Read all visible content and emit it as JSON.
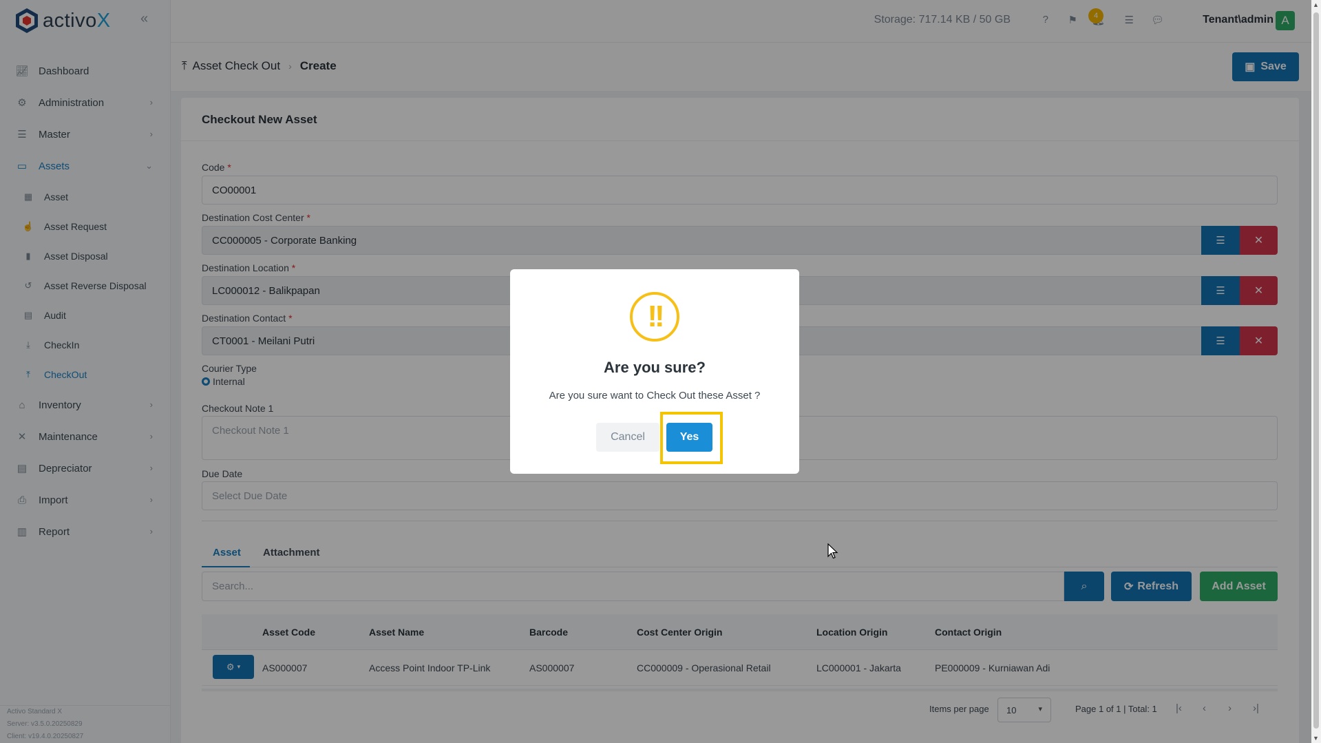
{
  "app": {
    "logo_prefix": "activo",
    "logo_suffix": "X"
  },
  "sidebar": {
    "items": [
      {
        "label": "Dashboard",
        "icon": "chart-icon"
      },
      {
        "label": "Administration",
        "icon": "gears-icon"
      },
      {
        "label": "Master",
        "icon": "database-icon"
      },
      {
        "label": "Assets",
        "icon": "laptop-icon"
      },
      {
        "label": "Inventory",
        "icon": "warehouse-icon"
      },
      {
        "label": "Maintenance",
        "icon": "tools-icon"
      },
      {
        "label": "Depreciator",
        "icon": "clipboard-icon"
      },
      {
        "label": "Import",
        "icon": "import-file-icon"
      },
      {
        "label": "Report",
        "icon": "report-chart-icon"
      }
    ],
    "sub_items": [
      {
        "label": "Asset"
      },
      {
        "label": "Asset Request"
      },
      {
        "label": "Asset Disposal"
      },
      {
        "label": "Asset Reverse Disposal"
      },
      {
        "label": "Audit"
      },
      {
        "label": "CheckIn"
      },
      {
        "label": "CheckOut"
      }
    ],
    "footer": {
      "product": "Activo Standard X",
      "server": "Server: v3.5.0.20250829",
      "client": "Client: v19.4.0.20250827"
    }
  },
  "topbar": {
    "storage": "Storage: 717.14 KB / 50 GB",
    "notification_count": "4",
    "user": "Tenant\\admin",
    "avatar_letter": "A"
  },
  "page_header": {
    "breadcrumb_parent": "Asset Check Out",
    "breadcrumb_current": "Create",
    "save_label": "Save"
  },
  "form": {
    "title": "Checkout New Asset",
    "code_label": "Code",
    "code_value": "CO00001",
    "cost_center_label": "Destination Cost Center",
    "cost_center_value": "CC000005 - Corporate Banking",
    "location_label": "Destination Location",
    "location_value": "LC000012 - Balikpapan",
    "contact_label": "Destination Contact",
    "contact_value": "CT0001 - Meilani Putri",
    "courier_label": "Courier Type",
    "courier_value": "Internal",
    "note_label": "Checkout Note 1",
    "note_placeholder": "Checkout Note 1",
    "due_label": "Due Date",
    "due_placeholder": "Select Due Date",
    "required_mark": "*"
  },
  "tabs": [
    {
      "label": "Asset"
    },
    {
      "label": "Attachment"
    }
  ],
  "asset_toolbar": {
    "search_placeholder": "Search...",
    "refresh_label": "Refresh",
    "add_label": "Add Asset"
  },
  "table": {
    "headers": [
      "Asset Code",
      "Asset Name",
      "Barcode",
      "Cost Center Origin",
      "Location Origin",
      "Contact Origin"
    ],
    "rows": [
      [
        "AS000007",
        "Access Point Indoor TP-Link",
        "AS000007",
        "CC000009 - Operasional Retail",
        "LC000001 - Jakarta",
        "PE000009 - Kurniawan Adi"
      ]
    ]
  },
  "pager": {
    "items_per_page_label": "Items per page",
    "items_per_page_value": "10",
    "summary": "Page 1 of 1 | Total: 1"
  },
  "modal": {
    "icon": "!!",
    "title": "Are you sure?",
    "text": "Are you sure want to Check Out these Asset ?",
    "cancel_label": "Cancel",
    "yes_label": "Yes"
  },
  "colors": {
    "primary": "#1474b4",
    "danger": "#d1344b",
    "success": "#2eaa66",
    "warning": "#f6c019",
    "highlight": "#f5c400"
  }
}
